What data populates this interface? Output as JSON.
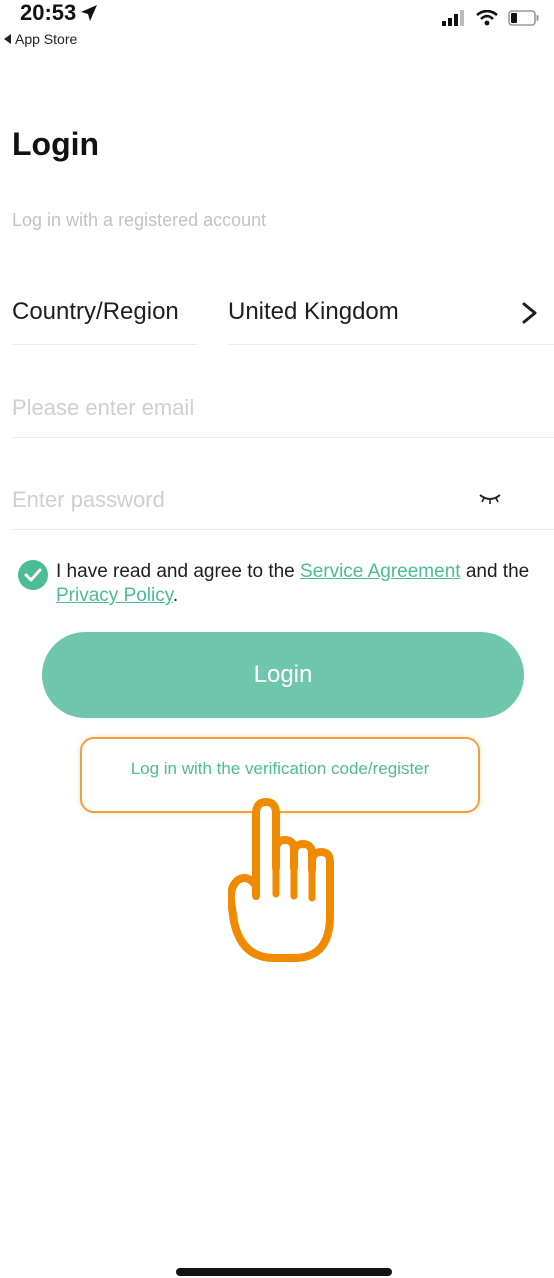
{
  "status_bar": {
    "time": "20:53",
    "back_label": "App Store"
  },
  "header": {
    "title": "Login",
    "subtitle": "Log in with a registered account"
  },
  "country": {
    "label": "Country/Region",
    "value": "United Kingdom"
  },
  "email": {
    "placeholder": "Please enter email",
    "value": ""
  },
  "password": {
    "placeholder": "Enter password",
    "value": ""
  },
  "agreement": {
    "checked": true,
    "text_before": "I have read and agree to the ",
    "service_link": "Service Agreement",
    "text_middle": " and the ",
    "privacy_link": "Privacy Policy",
    "text_after": "."
  },
  "login_button": {
    "label": "Login"
  },
  "verification_link": {
    "label": "Log in with the verification code/register"
  },
  "colors": {
    "accent": "#4dbb94",
    "button": "#6fc7ab",
    "highlight": "#f0a040"
  },
  "icons": {
    "location": "location-arrow-icon",
    "back": "back-triangle-icon",
    "signal": "cellular-signal-icon",
    "wifi": "wifi-icon",
    "battery": "battery-icon",
    "chevron": "chevron-right-icon",
    "eye": "eye-closed-icon",
    "check": "checkmark-icon",
    "hand": "pointing-hand-icon"
  }
}
